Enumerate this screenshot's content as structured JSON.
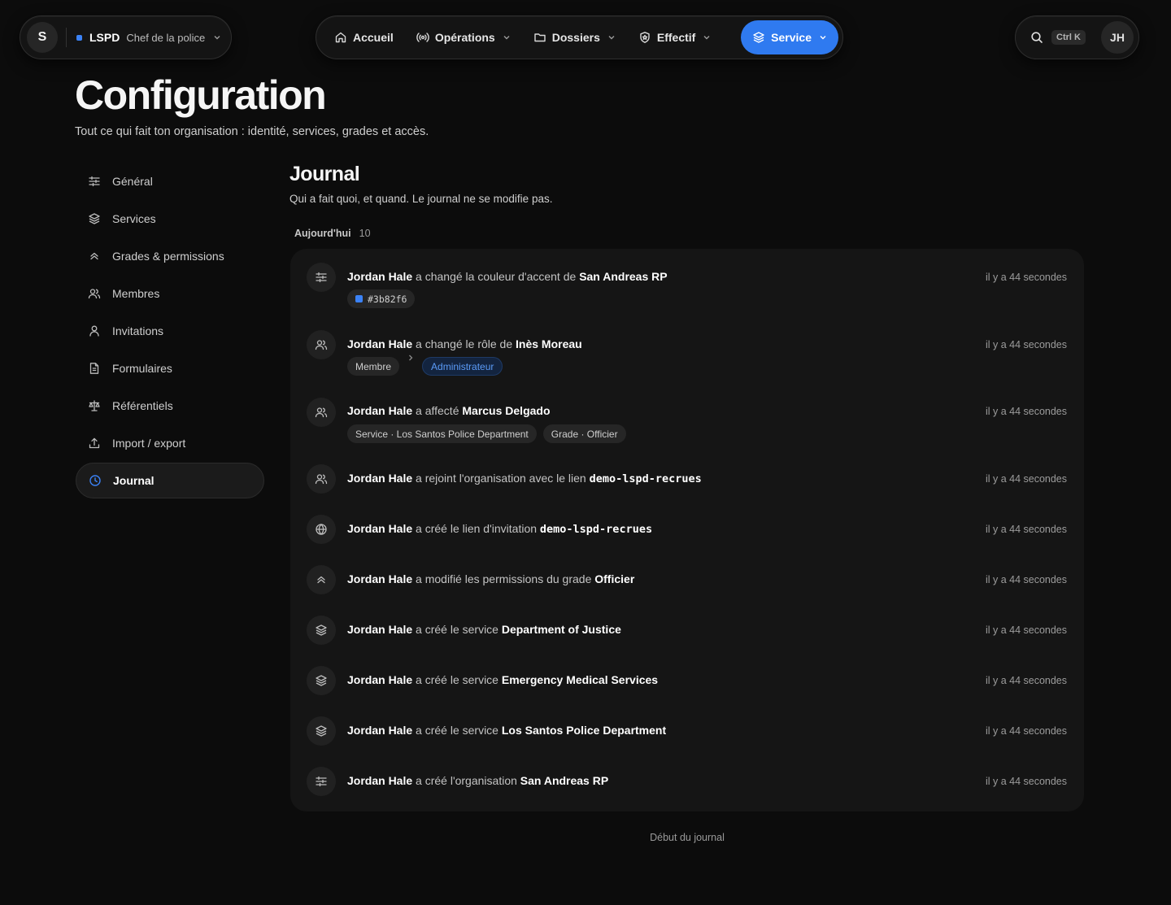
{
  "org": {
    "avatar": "S",
    "name": "LSPD",
    "role": "Chef de la police",
    "accent": "#3b82f6"
  },
  "nav": [
    {
      "label": "Accueil",
      "icon": "home-icon"
    },
    {
      "label": "Opérations",
      "icon": "radio-icon"
    },
    {
      "label": "Dossiers",
      "icon": "folder-icon"
    },
    {
      "label": "Effectif",
      "icon": "shield-icon"
    },
    {
      "label": "Service",
      "icon": "layers-icon",
      "active": true
    }
  ],
  "search": {
    "shortcut": "Ctrl K"
  },
  "user": {
    "initials": "JH"
  },
  "page": {
    "title": "Configuration",
    "subtitle": "Tout ce qui fait ton organisation : identité, services, grades et accès."
  },
  "sidebar": [
    {
      "label": "Général",
      "icon": "sliders-icon"
    },
    {
      "label": "Services",
      "icon": "layers-icon"
    },
    {
      "label": "Grades & permissions",
      "icon": "chevrons-up-icon"
    },
    {
      "label": "Membres",
      "icon": "users-icon"
    },
    {
      "label": "Invitations",
      "icon": "user-icon"
    },
    {
      "label": "Formulaires",
      "icon": "file-icon"
    },
    {
      "label": "Référentiels",
      "icon": "scale-icon"
    },
    {
      "label": "Import / export",
      "icon": "upload-icon"
    },
    {
      "label": "Journal",
      "icon": "clock-icon",
      "active": true
    }
  ],
  "journal": {
    "title": "Journal",
    "subtitle": "Qui a fait quoi, et quand. Le journal ne se modifie pas.",
    "day_label": "Aujourd'hui",
    "day_count": "10",
    "footer": "Début du journal",
    "entries": [
      {
        "icon": "sliders-icon",
        "actor": "Jordan Hale",
        "action": " a changé la couleur d'accent de ",
        "target": "San Andreas RP",
        "time": "il y a 44 secondes",
        "color_tag": {
          "value": "#3b82f6",
          "label": "#3b82f6"
        }
      },
      {
        "icon": "users-icon",
        "actor": "Jordan Hale",
        "action": " a changé le rôle de ",
        "target": "Inès Moreau",
        "time": "il y a 44 secondes",
        "from": "Membre",
        "to": "Administrateur"
      },
      {
        "icon": "users-icon",
        "actor": "Jordan Hale",
        "action": " a affecté ",
        "target": "Marcus Delgado",
        "time": "il y a 44 secondes",
        "tags": [
          "Service · Los Santos Police Department",
          "Grade · Officier"
        ]
      },
      {
        "icon": "users-icon",
        "actor": "Jordan Hale",
        "action": " a rejoint l'organisation avec le lien ",
        "target": "demo-lspd-recrues",
        "mono": true,
        "time": "il y a 44 secondes"
      },
      {
        "icon": "globe-icon",
        "actor": "Jordan Hale",
        "action": " a créé le lien d'invitation ",
        "target": "demo-lspd-recrues",
        "mono": true,
        "time": "il y a 44 secondes"
      },
      {
        "icon": "chevrons-up-icon",
        "actor": "Jordan Hale",
        "action": " a modifié les permissions du grade ",
        "target": "Officier",
        "time": "il y a 44 secondes"
      },
      {
        "icon": "layers-icon",
        "actor": "Jordan Hale",
        "action": " a créé le service ",
        "target": "Department of Justice",
        "time": "il y a 44 secondes"
      },
      {
        "icon": "layers-icon",
        "actor": "Jordan Hale",
        "action": " a créé le service ",
        "target": "Emergency Medical Services",
        "time": "il y a 44 secondes"
      },
      {
        "icon": "layers-icon",
        "actor": "Jordan Hale",
        "action": " a créé le service ",
        "target": "Los Santos Police Department",
        "time": "il y a 44 secondes"
      },
      {
        "icon": "sliders-icon",
        "actor": "Jordan Hale",
        "action": " a créé l'organisation ",
        "target": "San Andreas RP",
        "time": "il y a 44 secondes"
      }
    ]
  }
}
